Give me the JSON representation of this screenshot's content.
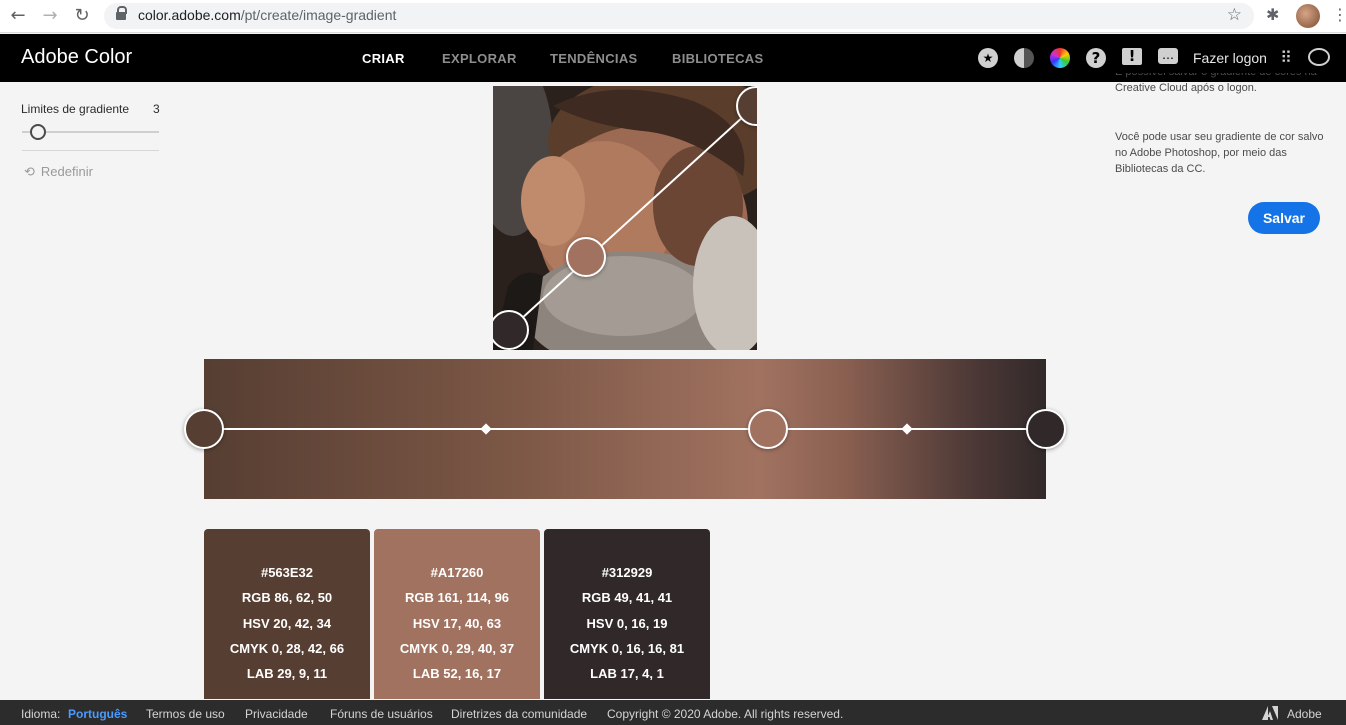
{
  "browser": {
    "url_host": "color.adobe.com",
    "url_path": "/pt/create/image-gradient",
    "back_icon": "arrow-left-icon",
    "forward_icon": "arrow-right-icon",
    "reload_icon": "reload-icon",
    "bookmark_icon": "star-icon",
    "extensions_icon": "puzzle-icon",
    "menu_icon": "kebab-icon"
  },
  "nav": {
    "brand": "Adobe Color",
    "tabs": [
      {
        "label": "CRIAR",
        "active": true
      },
      {
        "label": "EXPLORAR",
        "active": false
      },
      {
        "label": "TENDÊNCIAS",
        "active": false
      },
      {
        "label": "BIBLIOTECAS",
        "active": false
      }
    ],
    "login": "Fazer logon"
  },
  "sidebar": {
    "limit_label": "Limites de gradiente",
    "limit_value": "3",
    "slider_fraction": 0.05,
    "reset_label": "Redefinir"
  },
  "info": {
    "text_top": "É possível salvar o gradiente de cores na Creative Cloud após o logon.",
    "text_bottom": "Você pode usar seu gradiente de cor salvo no Adobe Photoshop, por meio das Bibliotecas da CC.",
    "save_label": "Salvar"
  },
  "gradient_stops": [
    "#563E32",
    "#A17260",
    "#312929"
  ],
  "swatches": [
    {
      "hex": "#563E32",
      "rgb": "RGB 86, 62, 50",
      "hsv": "HSV 20, 42, 34",
      "cmyk": "CMYK 0, 28, 42, 66",
      "lab": "LAB 29, 9, 11",
      "color": "#563E32"
    },
    {
      "hex": "#A17260",
      "rgb": "RGB 161, 114, 96",
      "hsv": "HSV 17, 40, 63",
      "cmyk": "CMYK 0, 29, 40, 37",
      "lab": "LAB 52, 16, 17",
      "color": "#A17260"
    },
    {
      "hex": "#312929",
      "rgb": "RGB 49, 41, 41",
      "hsv": "HSV 0, 16, 19",
      "cmyk": "CMYK 0, 16, 16, 81",
      "lab": "LAB 17, 4, 1",
      "color": "#312929"
    }
  ],
  "footer": {
    "language_label": "Idioma:",
    "language": "Português",
    "terms": "Termos de uso",
    "privacy": "Privacidade",
    "forums": "Fóruns de usuários",
    "guidelines": "Diretrizes da comunidade",
    "copyright": "Copyright © 2020 Adobe. All rights reserved.",
    "adobe": "Adobe"
  }
}
